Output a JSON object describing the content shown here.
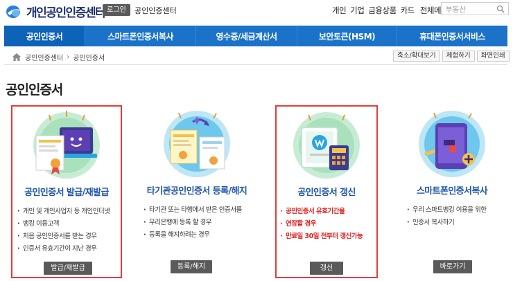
{
  "header": {
    "logo_text": "개인공인인증센터",
    "login_label": "로그인",
    "site_name": "공인인증센터",
    "util_links": [
      "개인",
      "기업",
      "금융상품",
      "카드",
      "전체메뉴"
    ],
    "search_placeholder": "부동산"
  },
  "nav": {
    "items": [
      {
        "label": "공인인증서",
        "active": true
      },
      {
        "label": "스마트폰인증서복사",
        "active": false
      },
      {
        "label": "영수증/세금계산서",
        "active": false
      },
      {
        "label": "보안토큰(HSM)",
        "active": false
      },
      {
        "label": "휴대폰인증서서비스",
        "active": false
      }
    ]
  },
  "breadcrumb": {
    "home_icon": "home-icon",
    "items": [
      "공인인증센터",
      "공인인증서"
    ]
  },
  "tools": [
    "축소/확대보기",
    "체험하기",
    "화면인쇄"
  ],
  "page_title": "공인인증서",
  "cards": [
    {
      "title": "공인인증서 발급/재발급",
      "bullets": [
        {
          "text": "개인 및 개인사업자 등 개인인터넷",
          "red": false
        },
        {
          "text": "뱅킹 이용고객",
          "red": false,
          "indent": true
        },
        {
          "text": "처음 공인인증서를 받는 경우",
          "red": false
        },
        {
          "text": "인증서 유효기간이 지난 경우",
          "red": false
        }
      ],
      "button": "발급/재발급",
      "highlighted": true
    },
    {
      "title": "타기관공인인증서 등록/해지",
      "bullets": [
        {
          "text": "타기관 또는 타행에서 받은 인증서를",
          "red": false
        },
        {
          "text": "우리은행에 등록 할 경우",
          "red": false,
          "indent": true
        },
        {
          "text": "등록을 해지하려는 경우",
          "red": false
        }
      ],
      "button": "등록/해지",
      "highlighted": false
    },
    {
      "title": "공인인증서 갱신",
      "bullets": [
        {
          "text": "공인인증서 유효기간을",
          "red": true
        },
        {
          "text": "연장할 경우",
          "red": true,
          "indent": true
        },
        {
          "text": "만료일 30일 전부터 갱신가능",
          "red": true
        }
      ],
      "button": "갱신",
      "highlighted": true
    },
    {
      "title": "스마트폰인증서복사",
      "bullets": [
        {
          "text": "우리 스마트뱅킹 이용을 위한",
          "red": false
        },
        {
          "text": "인증서 복사하기",
          "red": false,
          "indent": true
        }
      ],
      "button": "바로가기",
      "highlighted": false
    }
  ],
  "colors": {
    "nav_blue": "#1a72c9",
    "title_blue": "#1e55a8",
    "highlight_red": "#e53b3b",
    "notice_red": "#e02020"
  }
}
